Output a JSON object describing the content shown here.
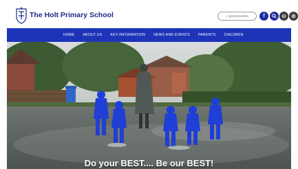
{
  "header": {
    "school_name": "The Holt Primary School",
    "quicklinks_label": "+ QUICKLINKS",
    "icons": [
      "facebook-icon",
      "search-icon",
      "translate-icon",
      "settings-icon"
    ]
  },
  "nav": {
    "items": [
      "HOME",
      "ABOUT US",
      "KEY INFORMATION",
      "NEWS AND EVENTS",
      "PARENTS",
      "CHILDREN"
    ]
  },
  "hero": {
    "slogan": "Do your BEST.... Be our BEST!"
  },
  "colors": {
    "brand_blue": "#1d34b8",
    "title_blue": "#1d2a8a",
    "raincoat_blue": "#1f3fd6"
  }
}
